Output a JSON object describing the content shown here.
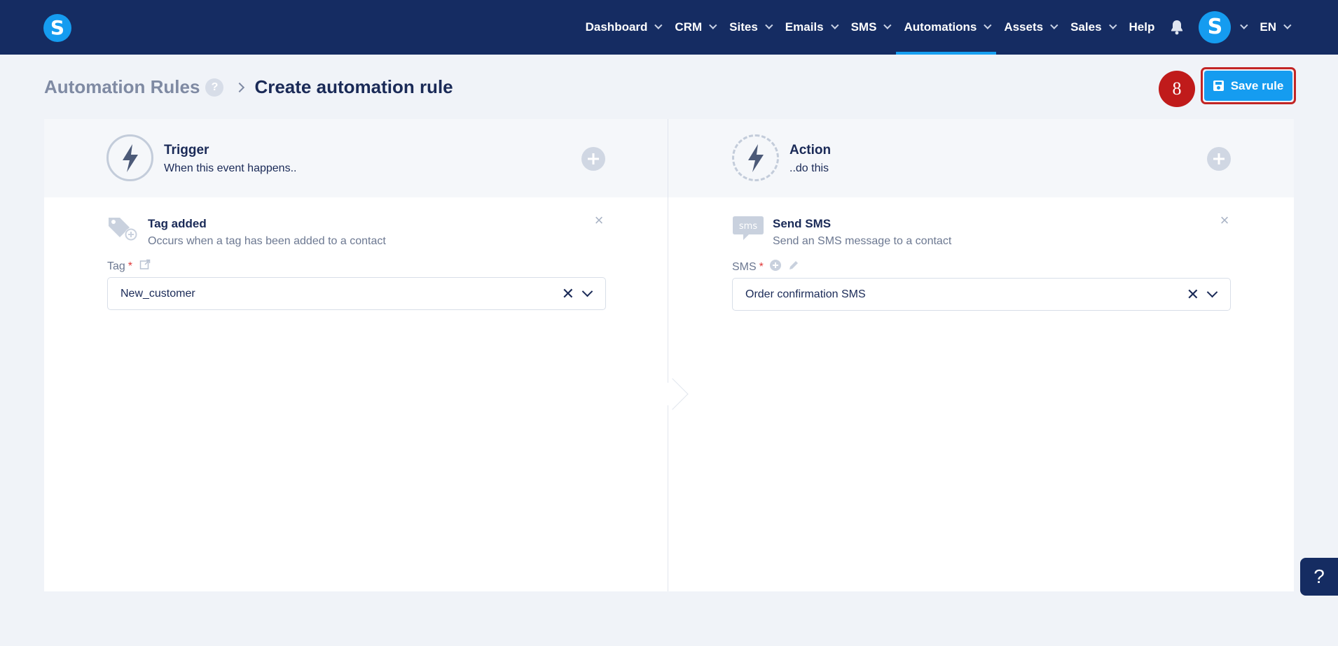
{
  "brand": {
    "logo_letter": "S"
  },
  "nav": {
    "items": [
      {
        "label": "Dashboard",
        "has_dropdown": true
      },
      {
        "label": "CRM",
        "has_dropdown": true
      },
      {
        "label": "Sites",
        "has_dropdown": true
      },
      {
        "label": "Emails",
        "has_dropdown": true
      },
      {
        "label": "SMS",
        "has_dropdown": true
      },
      {
        "label": "Automations",
        "has_dropdown": true,
        "active": true
      },
      {
        "label": "Assets",
        "has_dropdown": true
      },
      {
        "label": "Sales",
        "has_dropdown": true
      },
      {
        "label": "Help",
        "has_dropdown": false
      }
    ],
    "avatar_letter": "S",
    "language": "EN"
  },
  "breadcrumb": {
    "parent": "Automation Rules",
    "help": "?",
    "current": "Create automation rule"
  },
  "step_marker": "8",
  "save_button": {
    "label": "Save rule"
  },
  "trigger": {
    "title": "Trigger",
    "subtitle": "When this event happens..",
    "block": {
      "title": "Tag added",
      "description": "Occurs when a tag has been added to a contact",
      "field_label": "Tag",
      "required_mark": "*",
      "value": "New_customer"
    }
  },
  "action": {
    "title": "Action",
    "subtitle": "..do this",
    "block": {
      "icon_text": "sms",
      "title": "Send SMS",
      "description": "Send an SMS message to a contact",
      "field_label": "SMS",
      "required_mark": "*",
      "value": "Order confirmation SMS"
    }
  },
  "help_fab": "?",
  "colors": {
    "nav_bg": "#152c62",
    "accent": "#159cf0",
    "highlight": "#c01b1b"
  }
}
